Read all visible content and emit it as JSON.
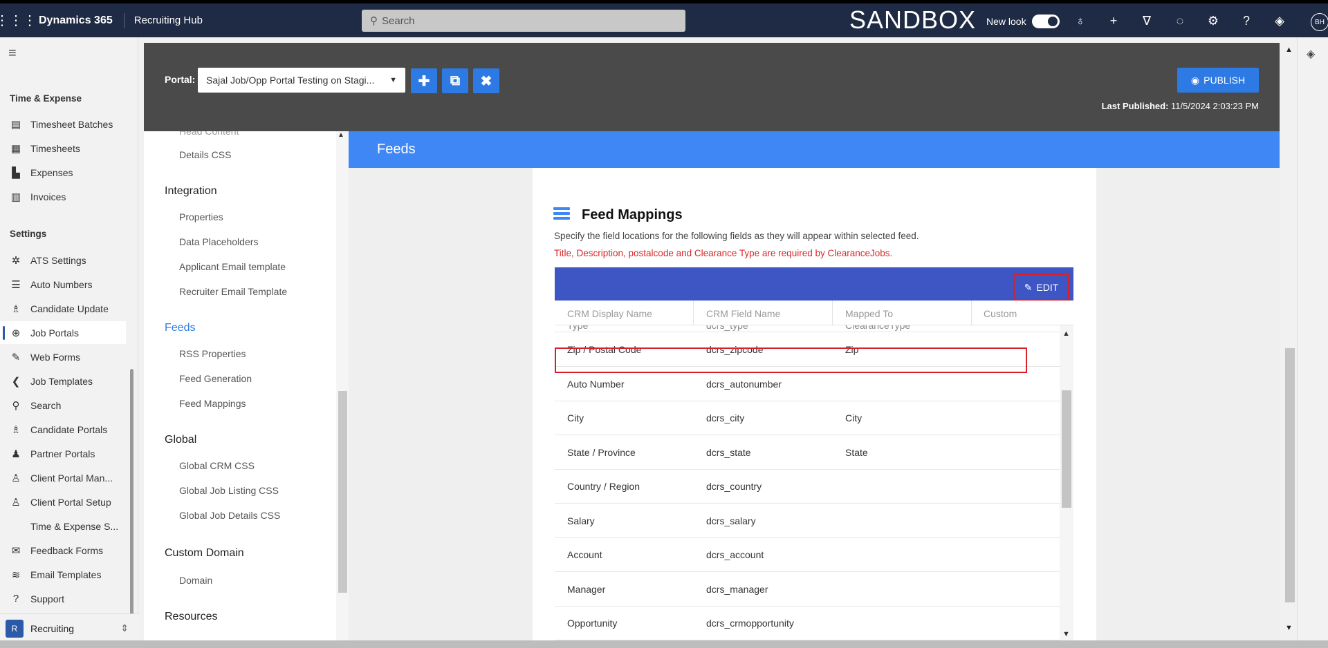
{
  "topnav": {
    "brand": "Dynamics 365",
    "app_name": "Recruiting Hub",
    "search_placeholder": "Search",
    "environment": "SANDBOX",
    "new_look_label": "New look",
    "avatar_initials": "BH",
    "icons": [
      "lightbulb-icon",
      "plus-icon",
      "filter-icon",
      "bell-icon",
      "gear-icon",
      "help-icon",
      "copilot-icon"
    ]
  },
  "leftnav": {
    "section_time": "Time & Expense",
    "section_settings": "Settings",
    "items": [
      {
        "label": "Timesheet Batches",
        "icon": "▤"
      },
      {
        "label": "Timesheets",
        "icon": "▦"
      },
      {
        "label": "Expenses",
        "icon": "▙"
      },
      {
        "label": "Invoices",
        "icon": "▥"
      },
      {
        "label": "ATS Settings",
        "icon": "✲"
      },
      {
        "label": "Auto Numbers",
        "icon": "☰"
      },
      {
        "label": "Candidate Update",
        "icon": "♗"
      },
      {
        "label": "Job Portals",
        "icon": "⊕"
      },
      {
        "label": "Web Forms",
        "icon": "✎"
      },
      {
        "label": "Job Templates",
        "icon": "❮"
      },
      {
        "label": "Search",
        "icon": "⚲"
      },
      {
        "label": "Candidate Portals",
        "icon": "♗"
      },
      {
        "label": "Partner Portals",
        "icon": "♟"
      },
      {
        "label": "Client Portal Man...",
        "icon": "♙"
      },
      {
        "label": "Client Portal Setup",
        "icon": "♙"
      },
      {
        "label": "Time & Expense S...",
        "icon": ""
      },
      {
        "label": "Feedback Forms",
        "icon": "✉"
      },
      {
        "label": "Email Templates",
        "icon": "≋"
      },
      {
        "label": "Support",
        "icon": "?"
      }
    ],
    "area": {
      "letter": "R",
      "label": "Recruiting"
    }
  },
  "portalbar": {
    "label": "Portal:",
    "selected": "Sajal Job/Opp Portal Testing on Stagi...",
    "publish_label": "PUBLISH",
    "last_published_label": "Last Published:",
    "last_published_value": "11/5/2024 2:03:23 PM"
  },
  "subnav": {
    "partial_top": "Head Content",
    "details_css": "Details CSS",
    "integration": "Integration",
    "integration_links": [
      "Properties",
      "Data Placeholders",
      "Applicant Email template",
      "Recruiter Email Template"
    ],
    "feeds": "Feeds",
    "feeds_links": [
      "RSS Properties",
      "Feed Generation",
      "Feed Mappings"
    ],
    "global": "Global",
    "global_links": [
      "Global CRM CSS",
      "Global Job Listing CSS",
      "Global Job Details CSS"
    ],
    "custom_domain": "Custom Domain",
    "domain_links": [
      "Domain"
    ],
    "resources": "Resources"
  },
  "feeds": {
    "header": "Feeds",
    "title": "Feed Mappings",
    "description": "Specify the field locations for the following fields as they will appear within selected feed.",
    "required_note": "Title, Description, postalcode and Clearance Type are required by ClearanceJobs.",
    "edit_label": "EDIT",
    "columns": [
      "CRM Display Name",
      "CRM Field Name",
      "Mapped To",
      "Custom"
    ],
    "partial_row": {
      "display": "Type",
      "field": "dcrs_type",
      "mapped": "ClearanceType"
    },
    "rows": [
      {
        "display": "Zip / Postal Code",
        "field": "dcrs_zipcode",
        "mapped": "Zip"
      },
      {
        "display": "Auto Number",
        "field": "dcrs_autonumber",
        "mapped": ""
      },
      {
        "display": "City",
        "field": "dcrs_city",
        "mapped": "City"
      },
      {
        "display": "State / Province",
        "field": "dcrs_state",
        "mapped": "State"
      },
      {
        "display": "Country / Region",
        "field": "dcrs_country",
        "mapped": ""
      },
      {
        "display": "Salary",
        "field": "dcrs_salary",
        "mapped": ""
      },
      {
        "display": "Account",
        "field": "dcrs_account",
        "mapped": ""
      },
      {
        "display": "Manager",
        "field": "dcrs_manager",
        "mapped": ""
      },
      {
        "display": "Opportunity",
        "field": "dcrs_crmopportunity",
        "mapped": ""
      }
    ]
  },
  "colors": {
    "topnav": "#1f2a44",
    "accent": "#3f87f5",
    "table_header": "#3e55c4",
    "required": "#d62828"
  }
}
